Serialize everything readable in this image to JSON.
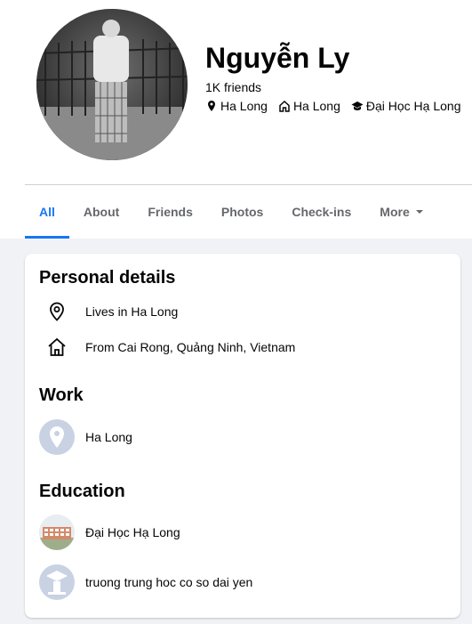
{
  "profile": {
    "name": "Nguyễn Ly",
    "friends": "1K friends",
    "meta": [
      {
        "icon": "location-pin-icon",
        "label": "Ha Long"
      },
      {
        "icon": "home-icon",
        "label": "Ha Long"
      },
      {
        "icon": "graduation-cap-icon",
        "label": "Đại Học Hạ Long"
      }
    ]
  },
  "tabs": [
    {
      "label": "All",
      "active": true
    },
    {
      "label": "About"
    },
    {
      "label": "Friends"
    },
    {
      "label": "Photos"
    },
    {
      "label": "Check-ins"
    },
    {
      "label": "More",
      "icon": "caret-down-icon"
    }
  ],
  "personal_details": {
    "title": "Personal details",
    "items": [
      {
        "icon": "location-pin-icon",
        "text": "Lives in Ha Long"
      },
      {
        "icon": "home-icon",
        "text": "From Cai Rong, Quảng Ninh, Vietnam"
      }
    ]
  },
  "work": {
    "title": "Work",
    "items": [
      {
        "icon": "workplace-placeholder-icon",
        "text": "Ha Long"
      }
    ]
  },
  "education": {
    "title": "Education",
    "items": [
      {
        "icon": "school-photo-thumbnail",
        "text": "Đại Học Hạ Long"
      },
      {
        "icon": "school-placeholder-icon",
        "text": "truong trung hoc co so dai yen"
      }
    ]
  },
  "colors": {
    "accent": "#1877f2",
    "muted_text": "#65676b",
    "page_bg": "#f0f2f5",
    "placeholder_bg": "#c9d2e3"
  }
}
